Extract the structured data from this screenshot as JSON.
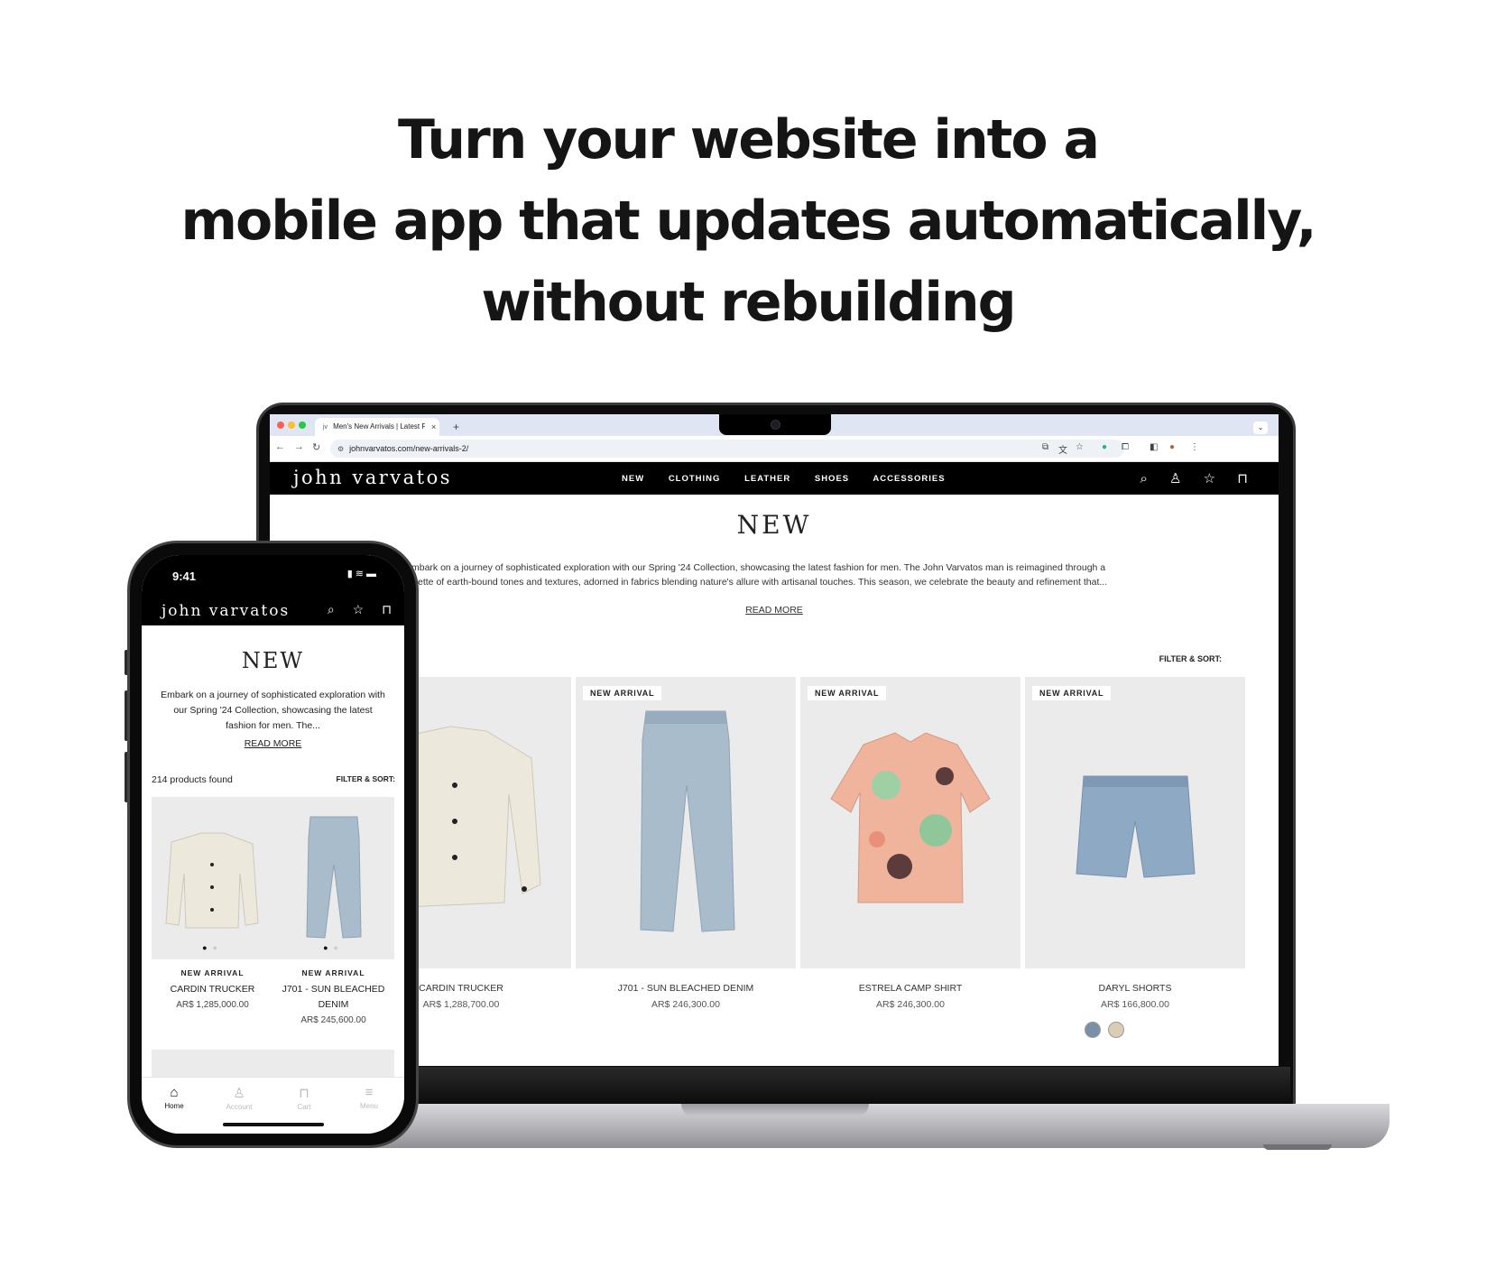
{
  "headline": {
    "line1": "Turn your website into a",
    "line2": "mobile app that updates automatically,",
    "line3": "without rebuilding"
  },
  "browser": {
    "tab_favicon": "jv",
    "tab_title": "Men's New Arrivals | Latest Fashion",
    "tab_close": "×",
    "tab_new": "+",
    "tab_dropdown": "⌄",
    "url": "johnvarvatos.com/new-arrivals-2/"
  },
  "site": {
    "brand": "john varvatos",
    "menu": [
      "NEW",
      "CLOTHING",
      "LEATHER",
      "SHOES",
      "ACCESSORIES"
    ],
    "title": "NEW",
    "description_line1": "Embark on a journey of sophisticated exploration with our Spring '24 Collection, showcasing the latest fashion for men. The John Varvatos man is reimagined through a",
    "description_line2": "palette of earth-bound tones and textures, adorned in fabrics blending nature's allure with artisanal touches. This season, we celebrate the beauty and refinement that...",
    "read_more": "READ MORE",
    "filter_sort": "FILTER & SORT:",
    "products": [
      {
        "badge": "",
        "name": "CARDIN TRUCKER",
        "price": "AR$ 1,288,700.00"
      },
      {
        "badge": "NEW ARRIVAL",
        "name": "J701 - SUN BLEACHED DENIM",
        "price": "AR$ 246,300.00"
      },
      {
        "badge": "NEW ARRIVAL",
        "name": "ESTRELA CAMP SHIRT",
        "price": "AR$ 246,300.00"
      },
      {
        "badge": "NEW ARRIVAL",
        "name": "DARYL SHORTS",
        "price": "AR$ 166,800.00"
      }
    ],
    "swatch_colors": [
      "#7a8fa8",
      "#d9cdb5"
    ]
  },
  "phone": {
    "time": "9:41",
    "brand": "john varvatos",
    "title": "NEW",
    "description": "Embark on a journey of sophisticated exploration with our Spring '24 Collection, showcasing the latest fashion for men. The...",
    "read_more": "READ MORE",
    "count": "214 products found",
    "filter_sort": "FILTER & SORT:",
    "products": [
      {
        "badge": "NEW ARRIVAL",
        "name": "CARDIN TRUCKER",
        "price": "AR$ 1,285,000.00"
      },
      {
        "badge": "NEW ARRIVAL",
        "name": "J701 - SUN BLEACHED DENIM",
        "price": "AR$ 245,600.00"
      }
    ],
    "tabs": [
      {
        "label": "Home",
        "icon": "home-icon"
      },
      {
        "label": "Account",
        "icon": "account-icon"
      },
      {
        "label": "Cart",
        "icon": "cart-icon"
      },
      {
        "label": "Menu",
        "icon": "menu-icon"
      }
    ]
  }
}
